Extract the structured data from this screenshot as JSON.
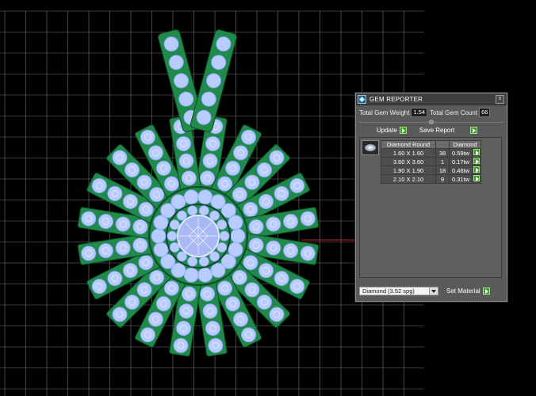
{
  "viewport": {
    "grid_color": "#9a9a9a",
    "axis_color": "#cc2222",
    "gem_fill": "#b9ccff",
    "metal_fill": "#1f8a4a",
    "metal_edge": "#0d4a26"
  },
  "gem_reporter": {
    "title": "GEM REPORTER",
    "close_glyph": "x",
    "total_weight_label": "Total Gem Weight",
    "total_weight_value": "1.54",
    "total_count_label": "Total Gem Count",
    "total_count_value": "66",
    "update_label": "Update",
    "save_report_label": "Save Report",
    "table": {
      "headers": [
        "Diamond Round",
        "",
        "Diamond"
      ],
      "rows": [
        [
          "1.60 X 1.60",
          "38",
          "0.59tw"
        ],
        [
          "3.60 X 3.60",
          "1",
          "0.17tw"
        ],
        [
          "1.90 X 1.90",
          "18",
          "0.46tw"
        ],
        [
          "2.10 X 2.10",
          "9",
          "0.31tw"
        ]
      ]
    },
    "material_select": "Diamond    (3.52 spg)",
    "set_material_label": "Set Material"
  }
}
